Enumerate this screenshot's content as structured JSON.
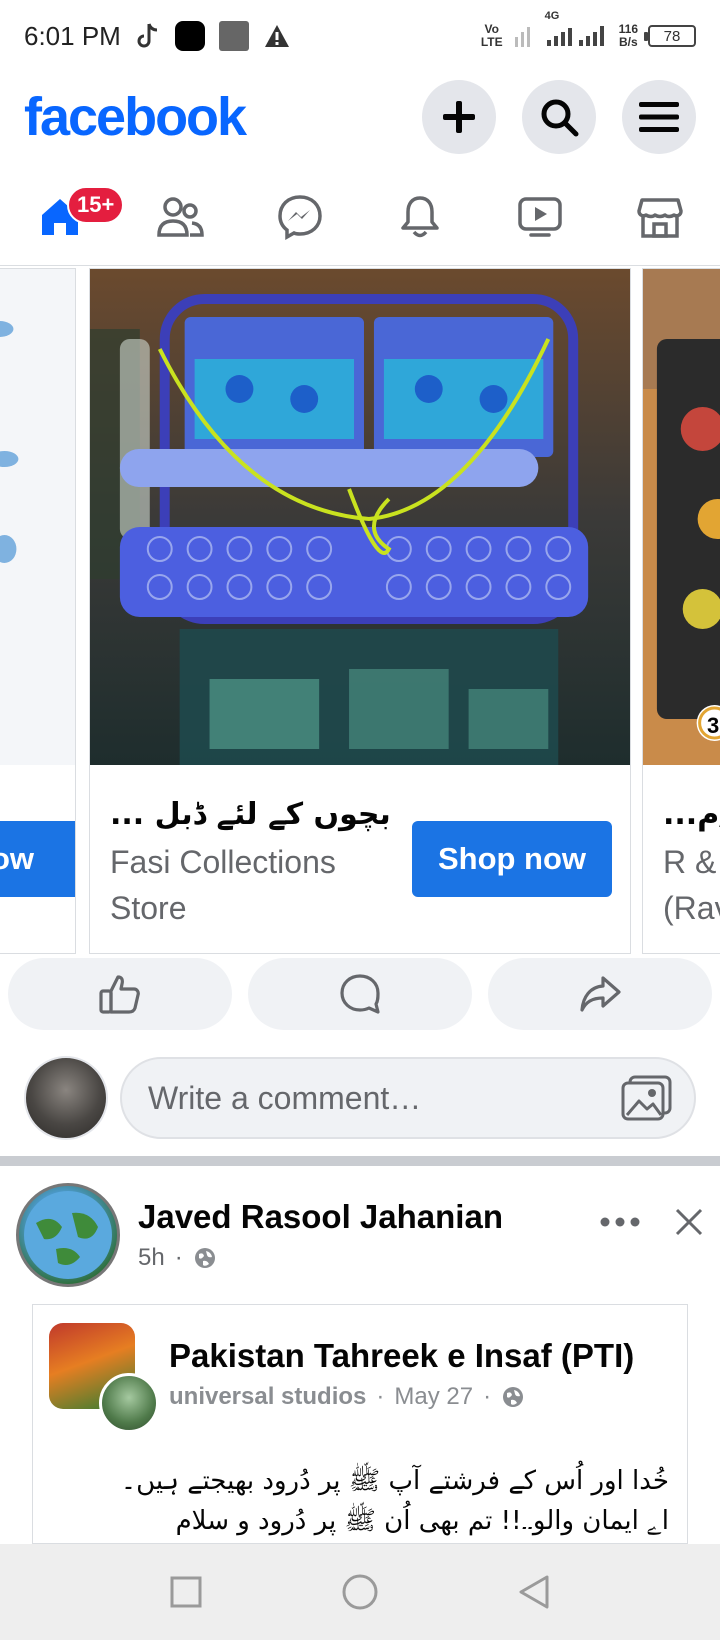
{
  "status_bar": {
    "time": "6:01 PM",
    "network_vo": "Vo",
    "network_lte": "LTE",
    "network_4g": "4G",
    "speed_value": "116",
    "speed_unit": "B/s",
    "battery": "78"
  },
  "header": {
    "logo": "facebook",
    "icons": [
      "plus-icon",
      "search-icon",
      "menu-icon"
    ]
  },
  "nav": {
    "items": [
      "home",
      "friends",
      "messenger",
      "notifications",
      "video",
      "marketplace"
    ],
    "home_badge": "15+",
    "accent": "#0866ff"
  },
  "carousel": {
    "left_card_button": "ow",
    "main_card": {
      "title": "بچوں کے لئے ڈبل ...",
      "store": "Fasi Collections Store",
      "button": "Shop now"
    },
    "right_card": {
      "title": "...م/",
      "store_line1": "R &",
      "store_line2": "(Rav",
      "price_fragment": "3"
    }
  },
  "post_actions": [
    "like-icon",
    "comment-icon",
    "share-icon"
  ],
  "comment_box": {
    "placeholder": "Write a comment…"
  },
  "post": {
    "author": "Javed Rasool Jahanian",
    "time": "5h",
    "dot": "·",
    "shared": {
      "page_name": "Pakistan Tahreek e Insaf (PTI)",
      "subtitle": "universal studios",
      "date": "May 27",
      "text_line1": "خُدا اور اُس کے فرشتے آپ ﷺ پر دُرود بھیجتے ہیں۔",
      "text_line2": "اے ایمان والو۔۔!! تم بھی اُن ﷺ پر دُرود و سلام"
    }
  },
  "colors": {
    "brand": "#0866ff",
    "button": "#1b74e4",
    "badge": "#e41e3f"
  }
}
